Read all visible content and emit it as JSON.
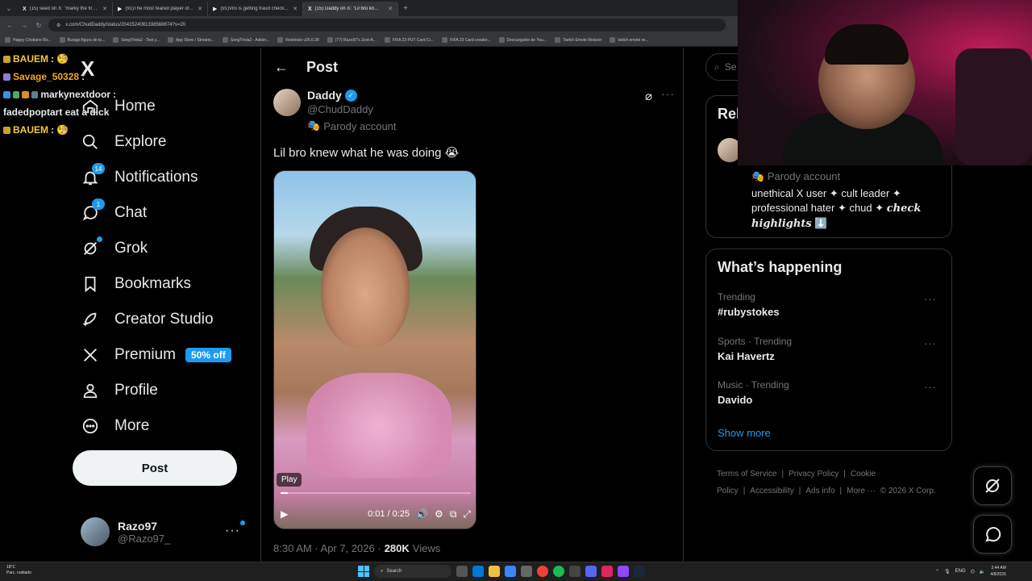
{
  "browser": {
    "tabs": [
      {
        "label": "(15) seed on X: \"marky the first...",
        "active": false
      },
      {
        "label": "(91)The most feared player of...",
        "active": false
      },
      {
        "label": "(91)Vini is getting fraud check...",
        "active": false
      },
      {
        "label": "(15) Daddy on X: \"Lil bro kn...",
        "active": true
      }
    ],
    "url": "x.com/ChudDaddy/status/2041524081338568874?s=20",
    "bookmarks": [
      "Happy Cristiano Ro...",
      "Burago figura de to...",
      "SongTrivia2 - Test y...",
      "App Store / Streami...",
      "SongTrivia2 - Adivin...",
      "Reletools v26.0.28",
      "(77) Razo97's Zest-A...",
      "FIFA 23 PUT Card Cr...",
      "FIFA 23 Card creator...",
      "Descargador de You...",
      "Twitch Emote Resizer",
      "twitch emote re..."
    ]
  },
  "stream_chat": [
    {
      "user": "BAUEM",
      "sep": " :",
      "msg": "",
      "color": "#f5c542"
    },
    {
      "user": "Savage_50328",
      "sep": " :",
      "msg": "",
      "color": "#f5a623"
    },
    {
      "user": "markynextdoor",
      "sep": " :",
      "msg": "",
      "color": "#ffffff"
    },
    {
      "user": "",
      "sep": "",
      "msg": "fadedpoptart eat a dick",
      "color": "#ffffff"
    },
    {
      "user": "BAUEM",
      "sep": " :",
      "msg": "",
      "color": "#f5c542"
    }
  ],
  "nav": {
    "logo": "X",
    "items": [
      {
        "label": "Home",
        "icon": "home-icon",
        "badge": ""
      },
      {
        "label": "Explore",
        "icon": "search-icon",
        "badge": ""
      },
      {
        "label": "Notifications",
        "icon": "bell-icon",
        "badge": "14"
      },
      {
        "label": "Chat",
        "icon": "chat-icon",
        "badge": "1"
      },
      {
        "label": "Grok",
        "icon": "grok-icon",
        "badge": ""
      },
      {
        "label": "Bookmarks",
        "icon": "bookmark-icon",
        "badge": ""
      },
      {
        "label": "Creator Studio",
        "icon": "rocket-icon",
        "badge": ""
      },
      {
        "label": "Premium",
        "icon": "x-icon",
        "badge": ""
      },
      {
        "label": "Profile",
        "icon": "person-icon",
        "badge": ""
      },
      {
        "label": "More",
        "icon": "more-circle-icon",
        "badge": ""
      }
    ],
    "premium_promo": "50% off",
    "post_button": "Post",
    "account": {
      "name": "Razo97",
      "handle": "@Razo97_"
    }
  },
  "post": {
    "header_title": "Post",
    "author_name": "Daddy",
    "author_handle": "@ChudDaddy",
    "parody_label": "Parody account",
    "text": "Lil bro knew what he was doing 😭",
    "video": {
      "play_label": "Play",
      "time": "0:01 / 0:25",
      "progress": 0.04
    },
    "time": "8:30 AM · Apr 7, 2026 ·",
    "views_count": "280K",
    "views_label": "Views"
  },
  "sidebar": {
    "search_placeholder": "Se",
    "relevant_title": "Rel",
    "parody_label": "Parody account",
    "bio_plain": "unethical X user ✦ cult leader ✦ professional hater ✦ chud ✦ ",
    "bio_styled": "check highlights",
    "bio_emoji": "⬇️",
    "happening_title": "What’s happening",
    "trends": [
      {
        "context": "Trending",
        "name": "#rubystokes"
      },
      {
        "context": "Sports · Trending",
        "name": "Kai Havertz"
      },
      {
        "context": "Music · Trending",
        "name": "Davido"
      }
    ],
    "show_more": "Show more",
    "footer_links": [
      "Terms of Service",
      "|",
      "Privacy Policy",
      "|",
      "Cookie Policy",
      "|",
      "Accessibility",
      "|",
      "Ads info",
      "|",
      "More ···",
      "© 2026 X Corp."
    ]
  },
  "taskbar": {
    "weather_temp": "18°C",
    "weather_desc": "Parc. nublado",
    "search_label": "Search",
    "lang": "ENG",
    "time": "2:44 AM",
    "date": "4/8/2026"
  },
  "colors": {
    "accent": "#1d9bf0",
    "background": "#000000",
    "text": "#e7e9ea",
    "muted": "#71767b",
    "border": "#2f3336"
  }
}
